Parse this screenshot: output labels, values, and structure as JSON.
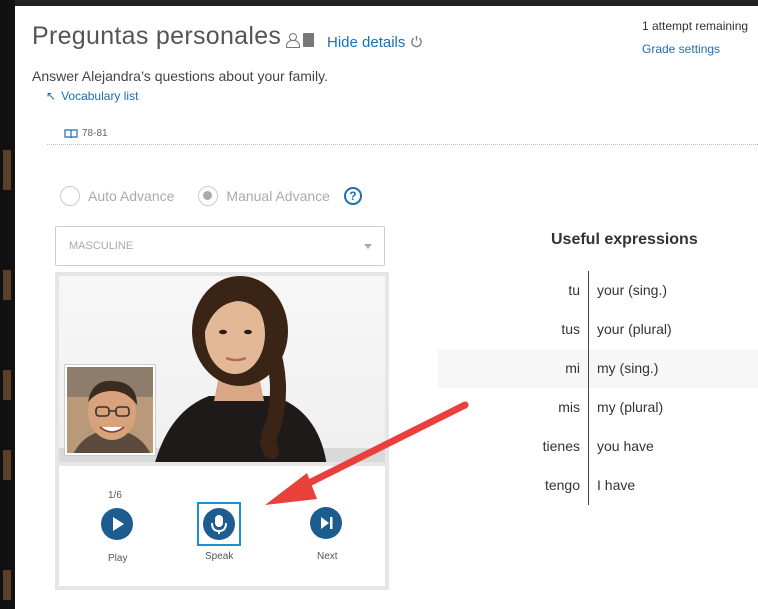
{
  "header": {
    "title": "Preguntas personales",
    "hide_details": "Hide details",
    "subtitle": "Answer Alejandra’s questions about your family.",
    "vocab_link": "Vocabulary list",
    "pages": "78-81",
    "attempts": "1 attempt remaining",
    "grade_settings": "Grade settings"
  },
  "player": {
    "auto_advance": "Auto Advance",
    "manual_advance": "Manual Advance",
    "help": "?",
    "select_value": "MASCULINE",
    "counter": "1/6",
    "play_label": "Play",
    "speak_label": "Speak",
    "next_label": "Next"
  },
  "expressions": {
    "title": "Useful expressions",
    "rows": [
      {
        "es": "tu",
        "en": "your (sing.)"
      },
      {
        "es": "tus",
        "en": "your (plural)"
      },
      {
        "es": "mi",
        "en": "my (sing.)"
      },
      {
        "es": "mis",
        "en": "my (plural)"
      },
      {
        "es": "tienes",
        "en": "you have"
      },
      {
        "es": "tengo",
        "en": "I have"
      }
    ]
  },
  "colors": {
    "accent": "#1a6fb5",
    "button": "#1d5c8f",
    "annotation_arrow": "#e8413b"
  }
}
